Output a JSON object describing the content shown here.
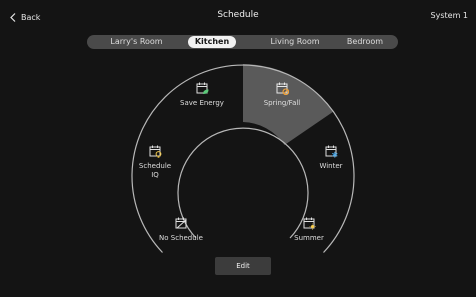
{
  "header": {
    "back_label": "Back",
    "title": "Schedule",
    "system_label": "System 1"
  },
  "tabs": [
    {
      "label": "Larry's Room",
      "active": false
    },
    {
      "label": "Kitchen",
      "active": true
    },
    {
      "label": "Living Room",
      "active": false
    },
    {
      "label": "Bedroom",
      "active": false
    }
  ],
  "modes": {
    "save_energy": {
      "label": "Save Energy",
      "icon": "calendar-leaf-icon"
    },
    "spring_fall": {
      "label": "Spring/Fall",
      "icon": "calendar-leaf-icon",
      "selected": true
    },
    "schedule_iq": {
      "label_line1": "Schedule",
      "label_line2": "IQ",
      "icon": "calendar-bulb-icon"
    },
    "winter": {
      "label": "Winter",
      "icon": "calendar-snowflake-icon"
    },
    "no_schedule": {
      "label": "No Schedule",
      "icon": "calendar-off-icon"
    },
    "summer": {
      "label": "Summer",
      "icon": "calendar-sun-icon"
    }
  },
  "edit_label": "Edit",
  "colors": {
    "background": "#141414",
    "accent_green": "#5cc97a",
    "accent_orange": "#f0a23a",
    "accent_yellow": "#f2c94c",
    "accent_blue": "#4aa8e8",
    "selected_segment": "#5a5a5a"
  }
}
